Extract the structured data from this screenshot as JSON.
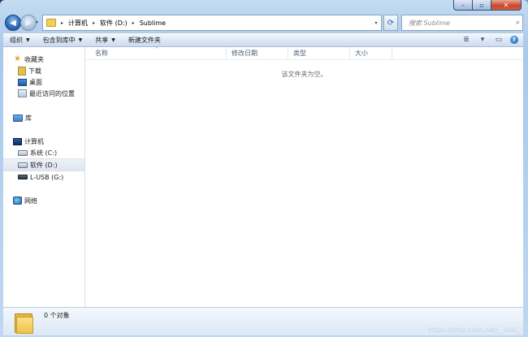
{
  "window": {
    "caption": {
      "minimize": "–",
      "maximize": "▫",
      "close": "✕"
    }
  },
  "address_bar": {
    "back_glyph": "◀",
    "forward_glyph": "▶",
    "history_glyph": "▾",
    "breadcrumbs": [
      "计算机",
      "软件 (D:)",
      "Sublime"
    ],
    "separator": "▸",
    "dropdown_glyph": "▾",
    "refresh_glyph": "⟳"
  },
  "search": {
    "placeholder": "搜索 Sublime",
    "icon_glyph": "⌕"
  },
  "toolbar": {
    "items": [
      "组织",
      "包含到库中",
      "共享",
      "新建文件夹"
    ],
    "dropdown_glyph": "▼",
    "view_icon": "≣",
    "view_drop": "▾",
    "preview_icon": "▭",
    "help_icon": "?"
  },
  "nav": {
    "favorites": {
      "label": "收藏夹",
      "items": [
        "下载",
        "桌面",
        "最近访问的位置"
      ]
    },
    "libraries": {
      "label": "库"
    },
    "computer": {
      "label": "计算机",
      "items": [
        "系统 (C:)",
        "软件 (D:)",
        "L-USB (G:)"
      ],
      "selected": "软件 (D:)"
    },
    "network": {
      "label": "网络"
    },
    "expander_glyph": "▸",
    "star_glyph": "★"
  },
  "file_list": {
    "columns": [
      "名称",
      "修改日期",
      "类型",
      "大小"
    ],
    "sort_glyph": "^",
    "empty_message": "该文件夹为空。"
  },
  "details": {
    "item_count": "0 个对象"
  },
  "watermark": "https://blog.csdn.net/__0u0_"
}
